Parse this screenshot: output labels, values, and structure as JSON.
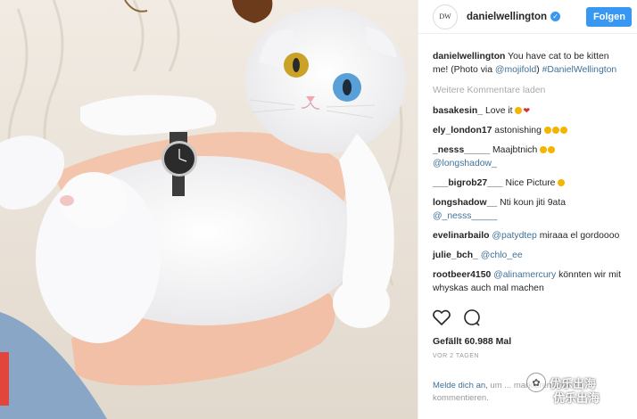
{
  "post": {
    "image_alt": "Photo of a person in a cream knit sweater holding a white cat with one yellow eye and one blue eye, wearing a wristwatch"
  },
  "header": {
    "logo_text": "DW",
    "username": "danielwellington",
    "follow_label": "Folgen"
  },
  "caption": {
    "user": "danielwellington",
    "text_1": " You have cat to be kitten me! (Photo via ",
    "mention": "@mojifold",
    "text_2": ") ",
    "hashtag": "#DanielWellington"
  },
  "load_more": "Weitere Kommentare laden",
  "comments": [
    {
      "user": "basakesin_",
      "text": "Love it",
      "emoji": "yellow-heart"
    },
    {
      "user": "ely_london17",
      "text": "astonishing",
      "emoji": "three-smiles"
    },
    {
      "user": "_nesss_____",
      "text": "Maajbtnich",
      "mention": "@longshadow_",
      "emoji": "two-smiles"
    },
    {
      "user": "___bigrob27___",
      "text": "Nice Picture",
      "emoji": "smile"
    },
    {
      "user": "longshadow__",
      "text": "Nti koun jiti 9ata",
      "mention": "@_nesss_____"
    },
    {
      "user": "evelinarbailo",
      "mention": "@patydtep",
      "text": "miraaa el gordoooo"
    },
    {
      "user": "julie_bch_",
      "mention": "@chlo_ee"
    },
    {
      "user": "rootbeer4150",
      "mention": "@alinamercury",
      "text": "könnten wir mit whyskas auch mal machen"
    }
  ],
  "likes": "Gefällt 60.988 Mal",
  "time": "VOR 2 TAGEN",
  "login": {
    "link": "Melde dich an,",
    "text": " um ... markieren oder zu kommentieren."
  },
  "watermark": {
    "line1": "优乐出海",
    "line2": "优乐出海"
  },
  "colors": {
    "accent": "#3897f0",
    "link": "#3f729b",
    "cat_eye_left": "#c9a227",
    "cat_eye_right": "#5aa0d8"
  }
}
